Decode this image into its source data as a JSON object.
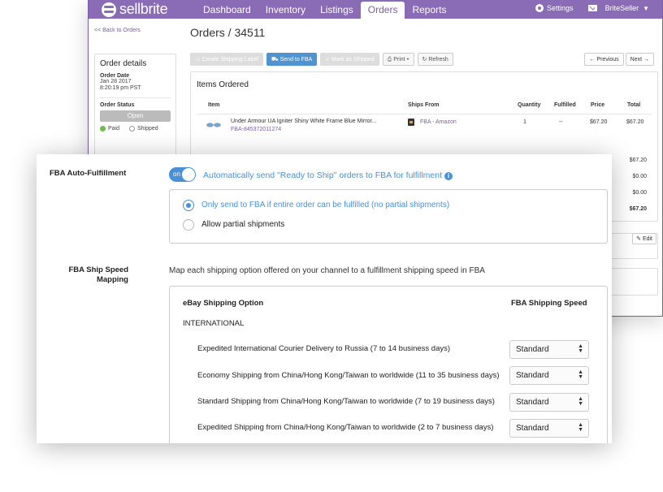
{
  "app": {
    "brand": "sellbrite",
    "nav_tabs": [
      "Dashboard",
      "Inventory",
      "Listings",
      "Orders",
      "Reports"
    ],
    "active_tab": "Orders",
    "settings_label": "Settings",
    "user_label": "BriteSeller"
  },
  "order_page": {
    "back_link": "<< Back to Orders",
    "title": "Orders / 34511",
    "toolbar": {
      "create_label": "Create Shipping Label",
      "send_fba_label": "Send to FBA",
      "mark_shipped_label": "Mark as Shipped",
      "print_label": "Print",
      "refresh_label": "Refresh",
      "previous_label": "Previous",
      "next_label": "Next"
    },
    "details": {
      "heading": "Order details",
      "date_label": "Order Date",
      "date_value": "Jan 28 2017",
      "time_value": "8:20:19 pm PST",
      "status_label": "Order Status",
      "status_value": "Open",
      "paid_label": "Paid",
      "shipped_label": "Shipped"
    },
    "items": {
      "heading": "Items Ordered",
      "columns": [
        "Item",
        "Ships From",
        "Quantity",
        "Fulfilled",
        "Price",
        "Total"
      ],
      "row": {
        "name": "Under Armour UA Igniter Shiny White Frame Blue Mirror...",
        "sku": "FBA-845372011274",
        "ships_from": "FBA - Amazon",
        "quantity": "1",
        "fulfilled": "--",
        "price": "$67.20",
        "total": "$67.20"
      },
      "totals": [
        "$67.20",
        "$0.00",
        "$0.00",
        "$67.20"
      ]
    },
    "edit_label": "Edit"
  },
  "fba_settings": {
    "auto_label": "FBA Auto-Fulfillment",
    "toggle_label": "on",
    "auto_text": "Automatically send \"Ready to Ship\" orders to FBA for fulfillment",
    "radio_options": [
      {
        "label": "Only send to FBA if entire order can be fulfilled (no partial shipments)",
        "checked": true
      },
      {
        "label": "Allow partial shipments",
        "checked": false
      }
    ],
    "speed_label_line1": "FBA Ship Speed",
    "speed_label_line2": "Mapping",
    "mapping_desc": "Map each shipping option offered on your channel to a fulfillment shipping speed in FBA",
    "table": {
      "col_option": "eBay Shipping Option",
      "col_speed": "FBA Shipping Speed",
      "region": "INTERNATIONAL",
      "rows": [
        {
          "option": "Expedited International Courier Delivery to Russia (7 to 14 business days)",
          "speed": "Standard"
        },
        {
          "option": "Economy Shipping from China/Hong Kong/Taiwan to worldwide (11 to 35 business days)",
          "speed": "Standard"
        },
        {
          "option": "Standard Shipping from China/Hong Kong/Taiwan to worldwide (7 to 19 business days)",
          "speed": "Standard"
        },
        {
          "option": "Expedited Shipping from China/Hong Kong/Taiwan to worldwide (2 to 7 business days)",
          "speed": "Standard"
        }
      ]
    }
  },
  "colors": {
    "brand_purple": "#8a6bb6",
    "accent_blue": "#4a90d9",
    "paid_green": "#6cc04a"
  }
}
